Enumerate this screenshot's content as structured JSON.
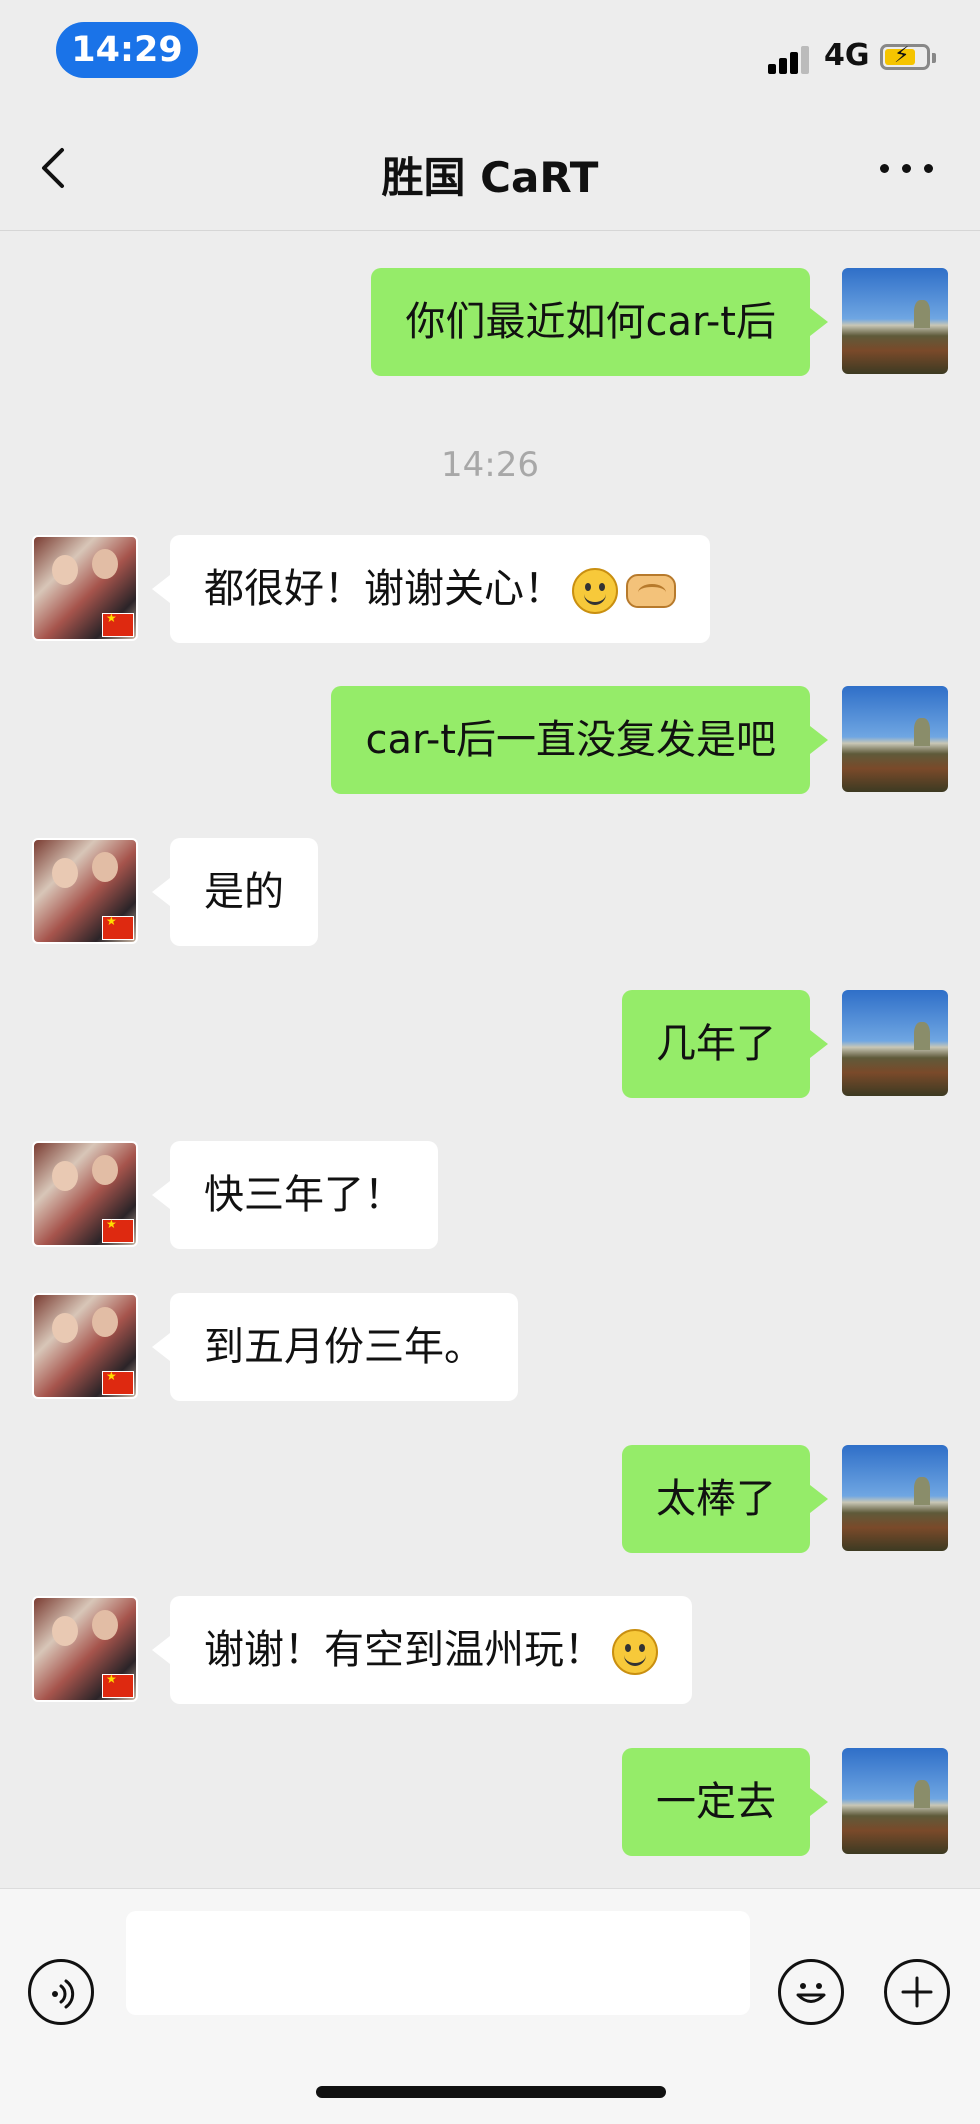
{
  "status": {
    "time": "14:29",
    "network": "4G"
  },
  "header": {
    "title": "胜国 CaRT"
  },
  "timestamp": "14:26",
  "messages": [
    {
      "side": "out",
      "text": "你们最近如何car-t后"
    },
    {
      "side": "in",
      "text": "都很好！谢谢关心！",
      "emojis": [
        "smile-emoji",
        "handshake-emoji"
      ]
    },
    {
      "side": "out",
      "text": "car-t后一直没复发是吧"
    },
    {
      "side": "in",
      "text": "是的"
    },
    {
      "side": "out",
      "text": "几年了"
    },
    {
      "side": "in",
      "text": "快三年了！"
    },
    {
      "side": "in",
      "text": "到五月份三年。"
    },
    {
      "side": "out",
      "text": "太棒了"
    },
    {
      "side": "in",
      "text": "谢谢！有空到温州玩！",
      "emojis": [
        "smile-emoji"
      ]
    },
    {
      "side": "out",
      "text": "一定去"
    }
  ],
  "input": {
    "value": ""
  },
  "colors": {
    "outgoing": "#95ec69",
    "incoming": "#ffffff",
    "background": "#ededed",
    "time_pill": "#1a73e8"
  },
  "icons": [
    "back-chevron-icon",
    "more-icon",
    "voice-icon",
    "emoji-icon",
    "plus-icon",
    "signal-icon",
    "battery-icon"
  ]
}
